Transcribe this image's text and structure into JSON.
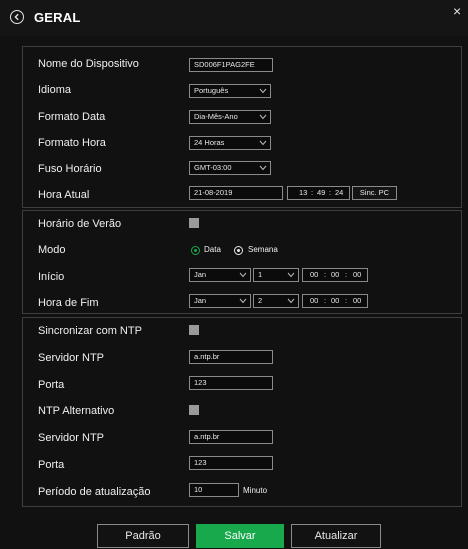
{
  "header": {
    "title": "GERAL"
  },
  "general": {
    "device_name_label": "Nome do Dispositivo",
    "device_name_value": "SD006F1PAG2FE",
    "language_label": "Idioma",
    "language_value": "Português",
    "date_format_label": "Formato Data",
    "date_format_value": "Dia-Mês-Ano",
    "time_format_label": "Formato Hora",
    "time_format_value": "24 Horas",
    "timezone_label": "Fuso Horário",
    "timezone_value": "GMT-03:00",
    "current_time_label": "Hora Atual",
    "current_date_value": "21-08-2019",
    "current_hour": "13",
    "current_minute": "49",
    "current_second": "24",
    "sync_pc_label": "Sinc. PC"
  },
  "dst": {
    "enable_label": "Horário de Verão",
    "mode_label": "Modo",
    "mode_option_date": "Data",
    "mode_option_week": "Semana",
    "start_label": "Início",
    "start_month": "Jan",
    "start_day": "1",
    "start_hour": "00",
    "start_minute": "00",
    "start_second": "00",
    "end_label": "Hora de Fim",
    "end_month": "Jan",
    "end_day": "2",
    "end_hour": "00",
    "end_minute": "00",
    "end_second": "00"
  },
  "ntp": {
    "sync_label": "Sincronizar com NTP",
    "server_label": "Servidor NTP",
    "server_value": "a.ntp.br",
    "port_label": "Porta",
    "port_value": "123",
    "alt_label": "NTP Alternativo",
    "alt_server_label": "Servidor NTP",
    "alt_server_value": "a.ntp.br",
    "alt_port_label": "Porta",
    "alt_port_value": "123",
    "update_period_label": "Período de atualização",
    "update_period_value": "10",
    "update_period_unit": "Minuto"
  },
  "footer": {
    "default_label": "Padrão",
    "save_label": "Salvar",
    "refresh_label": "Atualizar"
  },
  "colors": {
    "background": "#111111",
    "accent_green": "#17a94b",
    "text": "#f0f0f0"
  }
}
